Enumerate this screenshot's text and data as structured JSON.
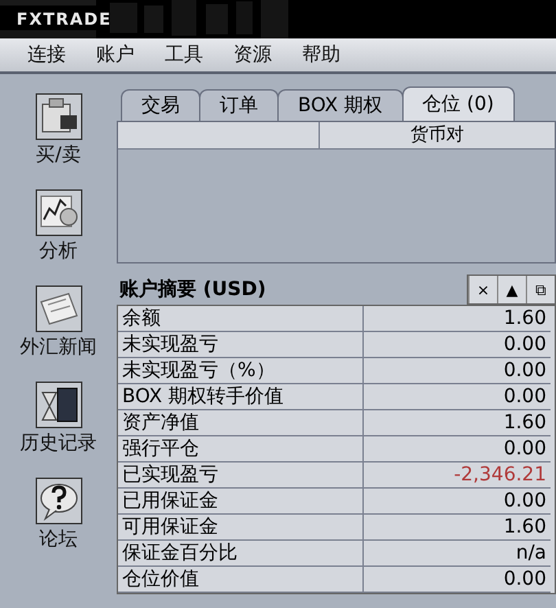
{
  "header": {
    "logo": "FXTRADE"
  },
  "menu": [
    "连接",
    "账户",
    "工具",
    "资源",
    "帮助"
  ],
  "sidebar": {
    "items": [
      {
        "label": "买/卖",
        "kind": "trade"
      },
      {
        "label": "分析",
        "kind": "chart"
      },
      {
        "label": "外汇新闻",
        "kind": "news"
      },
      {
        "label": "历史记录",
        "kind": "history"
      },
      {
        "label": "论坛",
        "kind": "forum"
      }
    ]
  },
  "tabs": [
    {
      "label": "交易",
      "selected": false
    },
    {
      "label": "订单",
      "selected": false
    },
    {
      "label": "BOX 期权",
      "selected": false
    },
    {
      "label": "仓位 (0)",
      "selected": true
    }
  ],
  "positions_table": {
    "columns": [
      "货币对"
    ]
  },
  "summary": {
    "title": "账户摘要 (USD)",
    "buttons": [
      "×",
      "▲",
      "⧉"
    ],
    "rows": [
      {
        "label": "余额",
        "value": "1.60",
        "color": "#000000"
      },
      {
        "label": "未实现盈亏",
        "value": "0.00",
        "color": "#000000"
      },
      {
        "label": "未实现盈亏（%）",
        "value": "0.00",
        "color": "#000000"
      },
      {
        "label": "BOX 期权转手价值",
        "value": "0.00",
        "color": "#000000"
      },
      {
        "label": "资产净值",
        "value": "1.60",
        "color": "#000000"
      },
      {
        "label": "强行平仓",
        "value": "0.00",
        "color": "#000000"
      },
      {
        "label": "已实现盈亏",
        "value": "-2,346.21",
        "color": "#b03a3a"
      },
      {
        "label": "已用保证金",
        "value": "0.00",
        "color": "#000000"
      },
      {
        "label": "可用保证金",
        "value": "1.60",
        "color": "#000000"
      },
      {
        "label": "保证金百分比",
        "value": "n/a",
        "color": "#000000"
      },
      {
        "label": "仓位价值",
        "value": "0.00",
        "color": "#000000"
      }
    ]
  }
}
